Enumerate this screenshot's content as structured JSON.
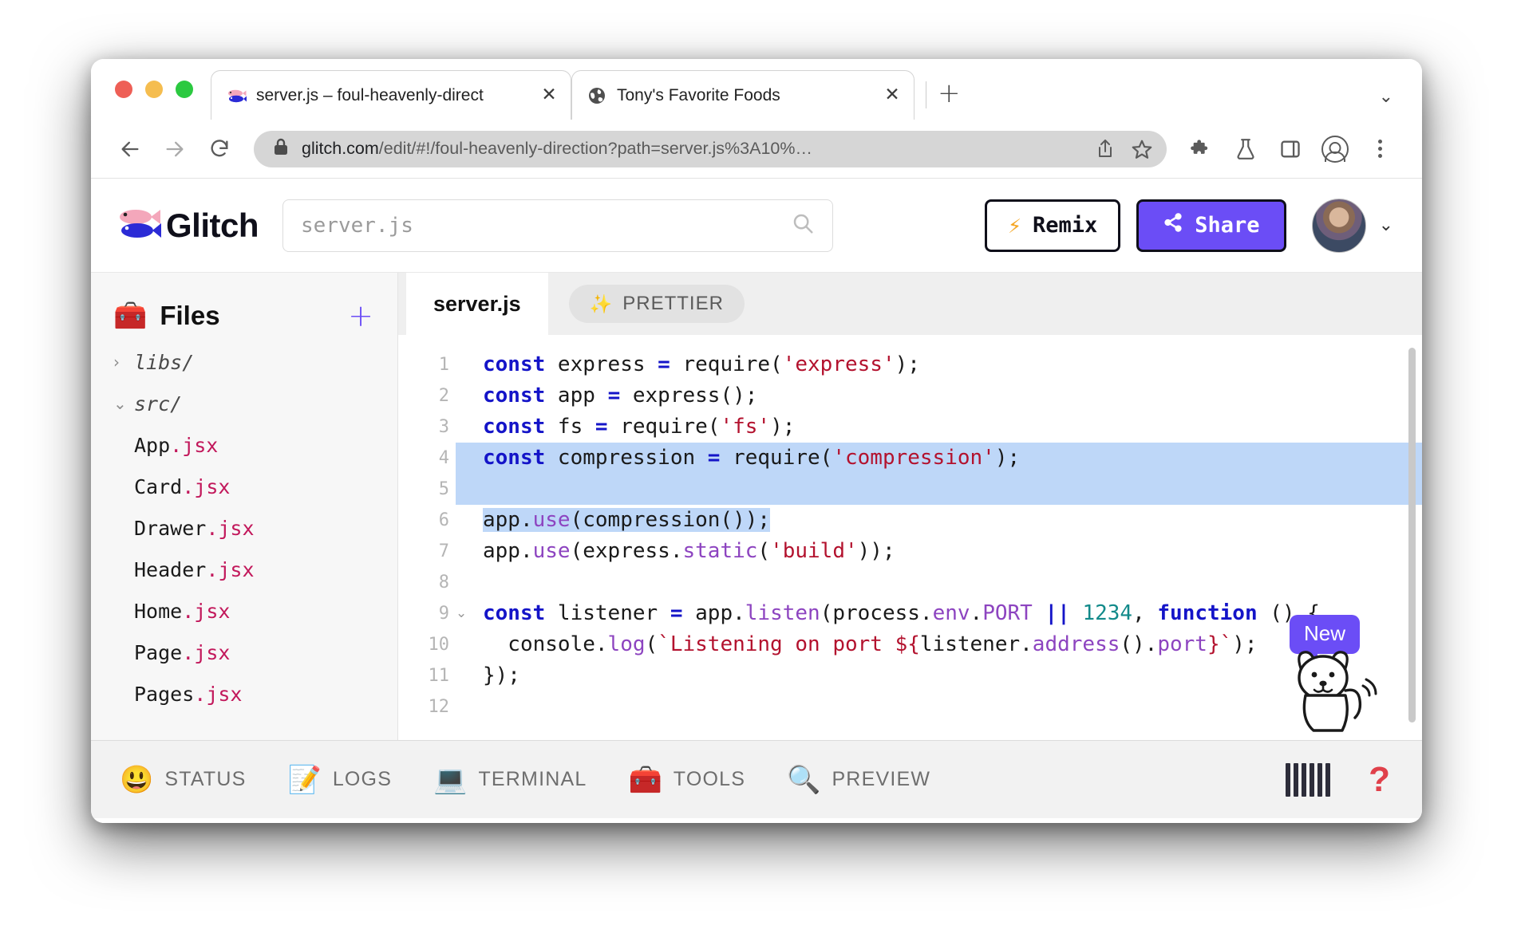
{
  "browser": {
    "traffic_lights": [
      "close",
      "minimize",
      "maximize"
    ],
    "tabs": [
      {
        "title": "server.js – foul-heavenly-direct",
        "favicon": "glitch-fish-icon",
        "active": true,
        "close_label": "✕"
      },
      {
        "title": "Tony's Favorite Foods",
        "favicon": "globe-icon",
        "active": false,
        "close_label": "✕"
      }
    ],
    "new_tab_label": "+",
    "tab_list_chevron": "⌄",
    "omnibox": {
      "url_domain": "glitch.com",
      "url_path": "/edit/#!/foul-heavenly-direction?path=server.js%3A10%…",
      "lock_icon": "lock-icon",
      "share_icon": "share-upload-icon",
      "bookmark_icon": "star-icon"
    },
    "toolbar_icons": [
      "extensions-puzzle-icon",
      "labs-flask-icon",
      "side-panel-icon",
      "profile-avatar-icon",
      "kebab-menu-icon"
    ],
    "nav": {
      "back": "back-arrow-icon",
      "forward": "forward-arrow-icon",
      "reload": "reload-icon"
    }
  },
  "app_header": {
    "logo_text": "Glitch",
    "logo_icon": "glitch-fish-logo",
    "search": {
      "value": "server.js",
      "placeholder": "server.js",
      "icon": "search-icon"
    },
    "remix_button": {
      "label": "Remix",
      "icon": "lightning-bolt-icon"
    },
    "share_button": {
      "label": "Share",
      "icon": "share-nodes-icon"
    },
    "account": {
      "avatar": "user-avatar",
      "caret": "⌄"
    },
    "accent_color": "#6b4df6"
  },
  "sidebar": {
    "title": "Files",
    "icon": "toolbox-icon",
    "add_label": "+",
    "tree": [
      {
        "type": "folder",
        "name": "libs/",
        "expanded": false,
        "chevron": "›"
      },
      {
        "type": "folder",
        "name": "src/",
        "expanded": true,
        "chevron": "⌄"
      },
      {
        "type": "file",
        "base": "App",
        "ext": ".jsx"
      },
      {
        "type": "file",
        "base": "Card",
        "ext": ".jsx"
      },
      {
        "type": "file",
        "base": "Drawer",
        "ext": ".jsx"
      },
      {
        "type": "file",
        "base": "Header",
        "ext": ".jsx"
      },
      {
        "type": "file",
        "base": "Home",
        "ext": ".jsx"
      },
      {
        "type": "file",
        "base": "Page",
        "ext": ".jsx"
      },
      {
        "type": "file",
        "base": "Pages",
        "ext": ".jsx"
      }
    ]
  },
  "editor": {
    "tab_label": "server.js",
    "prettier": {
      "label": "PRETTIER",
      "icon": "sparkles-icon"
    },
    "selection_lines": [
      4,
      5,
      6
    ],
    "lines": [
      {
        "num": "1",
        "fold": ""
      },
      {
        "num": "2",
        "fold": ""
      },
      {
        "num": "3",
        "fold": ""
      },
      {
        "num": "4",
        "fold": ""
      },
      {
        "num": "5",
        "fold": ""
      },
      {
        "num": "6",
        "fold": ""
      },
      {
        "num": "7",
        "fold": ""
      },
      {
        "num": "8",
        "fold": ""
      },
      {
        "num": "9",
        "fold": "⌄"
      },
      {
        "num": "10",
        "fold": ""
      },
      {
        "num": "11",
        "fold": ""
      },
      {
        "num": "12",
        "fold": ""
      }
    ],
    "code_text": [
      "const express = require('express');",
      "const app = express();",
      "const fs = require('fs');",
      "const compression = require('compression');",
      "",
      "app.use(compression());",
      "app.use(express.static('build'));",
      "",
      "const listener = app.listen(process.env.PORT || 1234, function () {",
      "  console.log(`Listening on port ${listener.address().port}`);",
      "});",
      ""
    ],
    "mascot": {
      "badge": "New",
      "icon": "dog-mascot-icon"
    }
  },
  "bottom_bar": {
    "items": [
      {
        "label": "STATUS",
        "icon": "smiley-face-icon",
        "emoji": "😃"
      },
      {
        "label": "LOGS",
        "icon": "memo-pencil-icon",
        "emoji": "📝"
      },
      {
        "label": "TERMINAL",
        "icon": "laptop-icon",
        "emoji": "💻"
      },
      {
        "label": "TOOLS",
        "icon": "toolbox-icon",
        "emoji": "🧰"
      },
      {
        "label": "PREVIEW",
        "icon": "magnifier-icon",
        "emoji": "🔍"
      }
    ],
    "piano_icon": "piano-keys-icon",
    "help_icon": "question-mark-icon",
    "help_label": "?"
  }
}
